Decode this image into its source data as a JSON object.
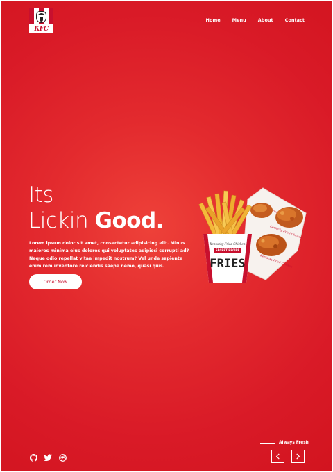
{
  "brand": {
    "logo_text": "KFC"
  },
  "nav": {
    "items": [
      "Home",
      "Menu",
      "About",
      "Contact"
    ]
  },
  "hero": {
    "title_line1": "Its",
    "title_line2_light": "Lickin",
    "title_line2_bold": "Good.",
    "description": "Lorem ipsum dolor sit amet, consectetur adipisicing elit. Minus maiores minima eius dolores qui voluptates adipisci corrupti ad? Neque odio repellat vitae impedit nostrum? Vel unde sapiente enim rem inventore reiciendis saepe nemo, quasi quis.",
    "cta_label": "Order Now"
  },
  "product": {
    "box_brand": "Kentucky Fried Chicken",
    "box_badge": "SECRET RECIPE",
    "box_name": "FRIES"
  },
  "social": {
    "icons": [
      "github-icon",
      "twitter-icon",
      "dribbble-icon"
    ]
  },
  "slider": {
    "tagline": "Always Fresh"
  },
  "colors": {
    "brand_red": "#c8102e",
    "background": "#e32a2e"
  }
}
